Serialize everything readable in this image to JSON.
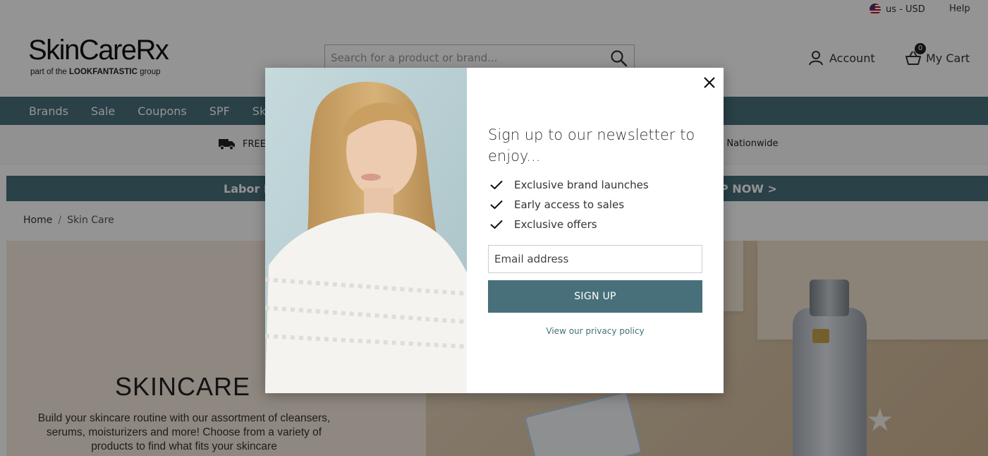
{
  "topbar": {
    "locale": "us - USD",
    "help": "Help"
  },
  "header": {
    "logo_text": "SkinCareRx",
    "logo_tag_prefix": "part of the ",
    "logo_tag_brand": "LOOKFANTASTIC",
    "logo_tag_suffix": " group",
    "search_placeholder": "Search for a product or brand...",
    "account_label": "Account",
    "cart_label": "My Cart",
    "cart_count": "0"
  },
  "nav": {
    "items": [
      "Brands",
      "Sale",
      "Coupons",
      "SPF",
      "Ski"
    ]
  },
  "benefits": {
    "free_shipping": "FREE",
    "nationwide": "g Nationwide"
  },
  "promo": {
    "left_text": "Labor D",
    "right_text": "P NOW >"
  },
  "breadcrumb": {
    "home": "Home",
    "separator": "/",
    "current": "Skin Care"
  },
  "hero": {
    "title": "SKINCARE",
    "description": "Build your skincare routine with our assortment of cleansers, serums, moisturizers and more! Choose from a variety of products to find what fits your skincare"
  },
  "modal": {
    "title": "Sign up to our newsletter to enjoy...",
    "benefits": [
      "Exclusive brand launches",
      "Early access to sales",
      "Exclusive offers"
    ],
    "email_placeholder": "Email address",
    "signup_label": "SIGN UP",
    "privacy_link": "View our privacy policy"
  },
  "colors": {
    "brand_teal": "#47707b",
    "overlay": "rgba(0,0,0,0.42)"
  },
  "icons": [
    "us-flag-icon",
    "search-icon",
    "user-icon",
    "basket-icon",
    "truck-icon",
    "close-icon",
    "checkmark-icon"
  ]
}
